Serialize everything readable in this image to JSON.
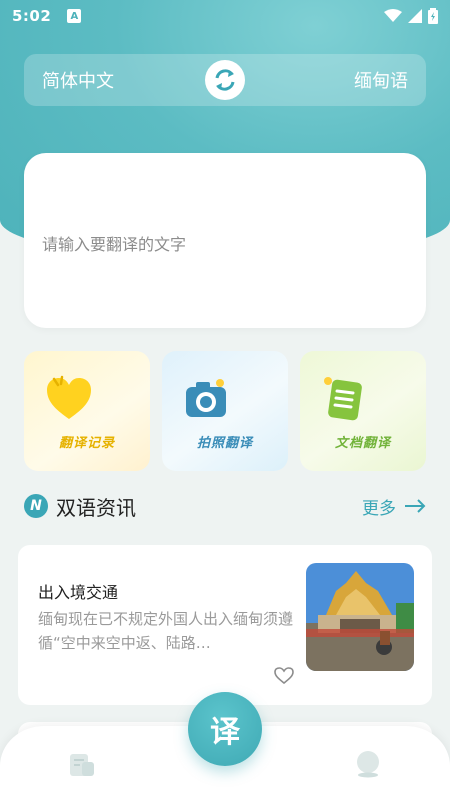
{
  "status_bar": {
    "time": "5:02",
    "notif_letter": "A"
  },
  "lang_bar": {
    "source": "简体中文",
    "target": "缅甸语",
    "swap_icon": "swap-icon"
  },
  "input": {
    "placeholder": "请输入要翻译的文字"
  },
  "features": [
    {
      "label": "翻译记录",
      "icon": "heart-icon",
      "color": "#e6b200"
    },
    {
      "label": "拍照翻译",
      "icon": "camera-icon",
      "color": "#3a8db8"
    },
    {
      "label": "文档翻译",
      "icon": "document-icon",
      "color": "#72b33a"
    }
  ],
  "section": {
    "badge": "N",
    "title": "双语资讯",
    "more": "更多"
  },
  "news": [
    {
      "title": "出入境交通",
      "body": "缅甸现在已不规定外国人出入缅甸须遵循“空中来空中返、陆路…"
    }
  ],
  "fab": {
    "label": "译"
  },
  "colors": {
    "accent": "#3aa6b6",
    "hero": "#4db2ba"
  }
}
